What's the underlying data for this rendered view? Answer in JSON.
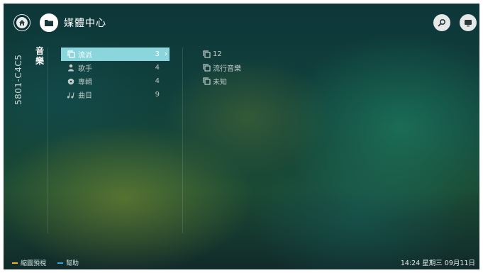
{
  "header": {
    "title": "媒體中心",
    "home_icon": "home-icon",
    "source_icon": "folder-icon",
    "search_icon": "search-icon",
    "tv_icon": "tv-icon"
  },
  "sidebar": {
    "device_id": "5801-C4C5",
    "category": "音樂"
  },
  "menu": {
    "items": [
      {
        "icon": "playlist-icon",
        "label": "流派",
        "count": "3",
        "arrow": "›",
        "selected": true
      },
      {
        "icon": "artist-icon",
        "label": "歌手",
        "count": "4"
      },
      {
        "icon": "album-icon",
        "label": "專輯",
        "count": "4"
      },
      {
        "icon": "music-note-icon",
        "label": "曲目",
        "count": "9"
      }
    ]
  },
  "content": {
    "items": [
      {
        "icon": "playlist-icon",
        "label": "12"
      },
      {
        "icon": "playlist-icon",
        "label": "流行音樂"
      },
      {
        "icon": "playlist-icon",
        "label": "未知"
      }
    ]
  },
  "footer": {
    "yellow_label": "縮圖預視",
    "blue_label": "幫助",
    "clock": "14:24 星期三 09月11日",
    "colors": {
      "yellow": "#f2b01e",
      "blue": "#2aa7e0"
    }
  },
  "colors": {
    "accent": "#8ad6dc"
  }
}
